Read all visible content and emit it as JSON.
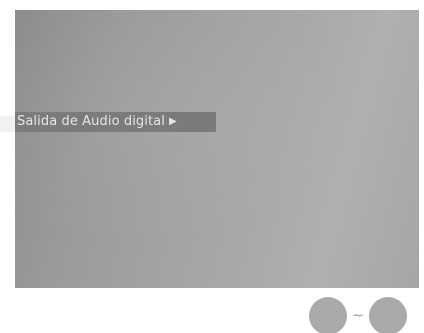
{
  "menu": {
    "label": "Salida de Audio digital",
    "arrow_icon": "right-triangle-icon",
    "arrow_glyph": "▶"
  },
  "buttons": {
    "range_separator": "~",
    "first_icon": "round-button-icon",
    "last_icon": "round-button-icon"
  },
  "colors": {
    "screen": "#a0a0a0",
    "menu_bar": "#7b7b7b",
    "menu_text": "#e6e6e6",
    "button": "#aaaaaa"
  }
}
